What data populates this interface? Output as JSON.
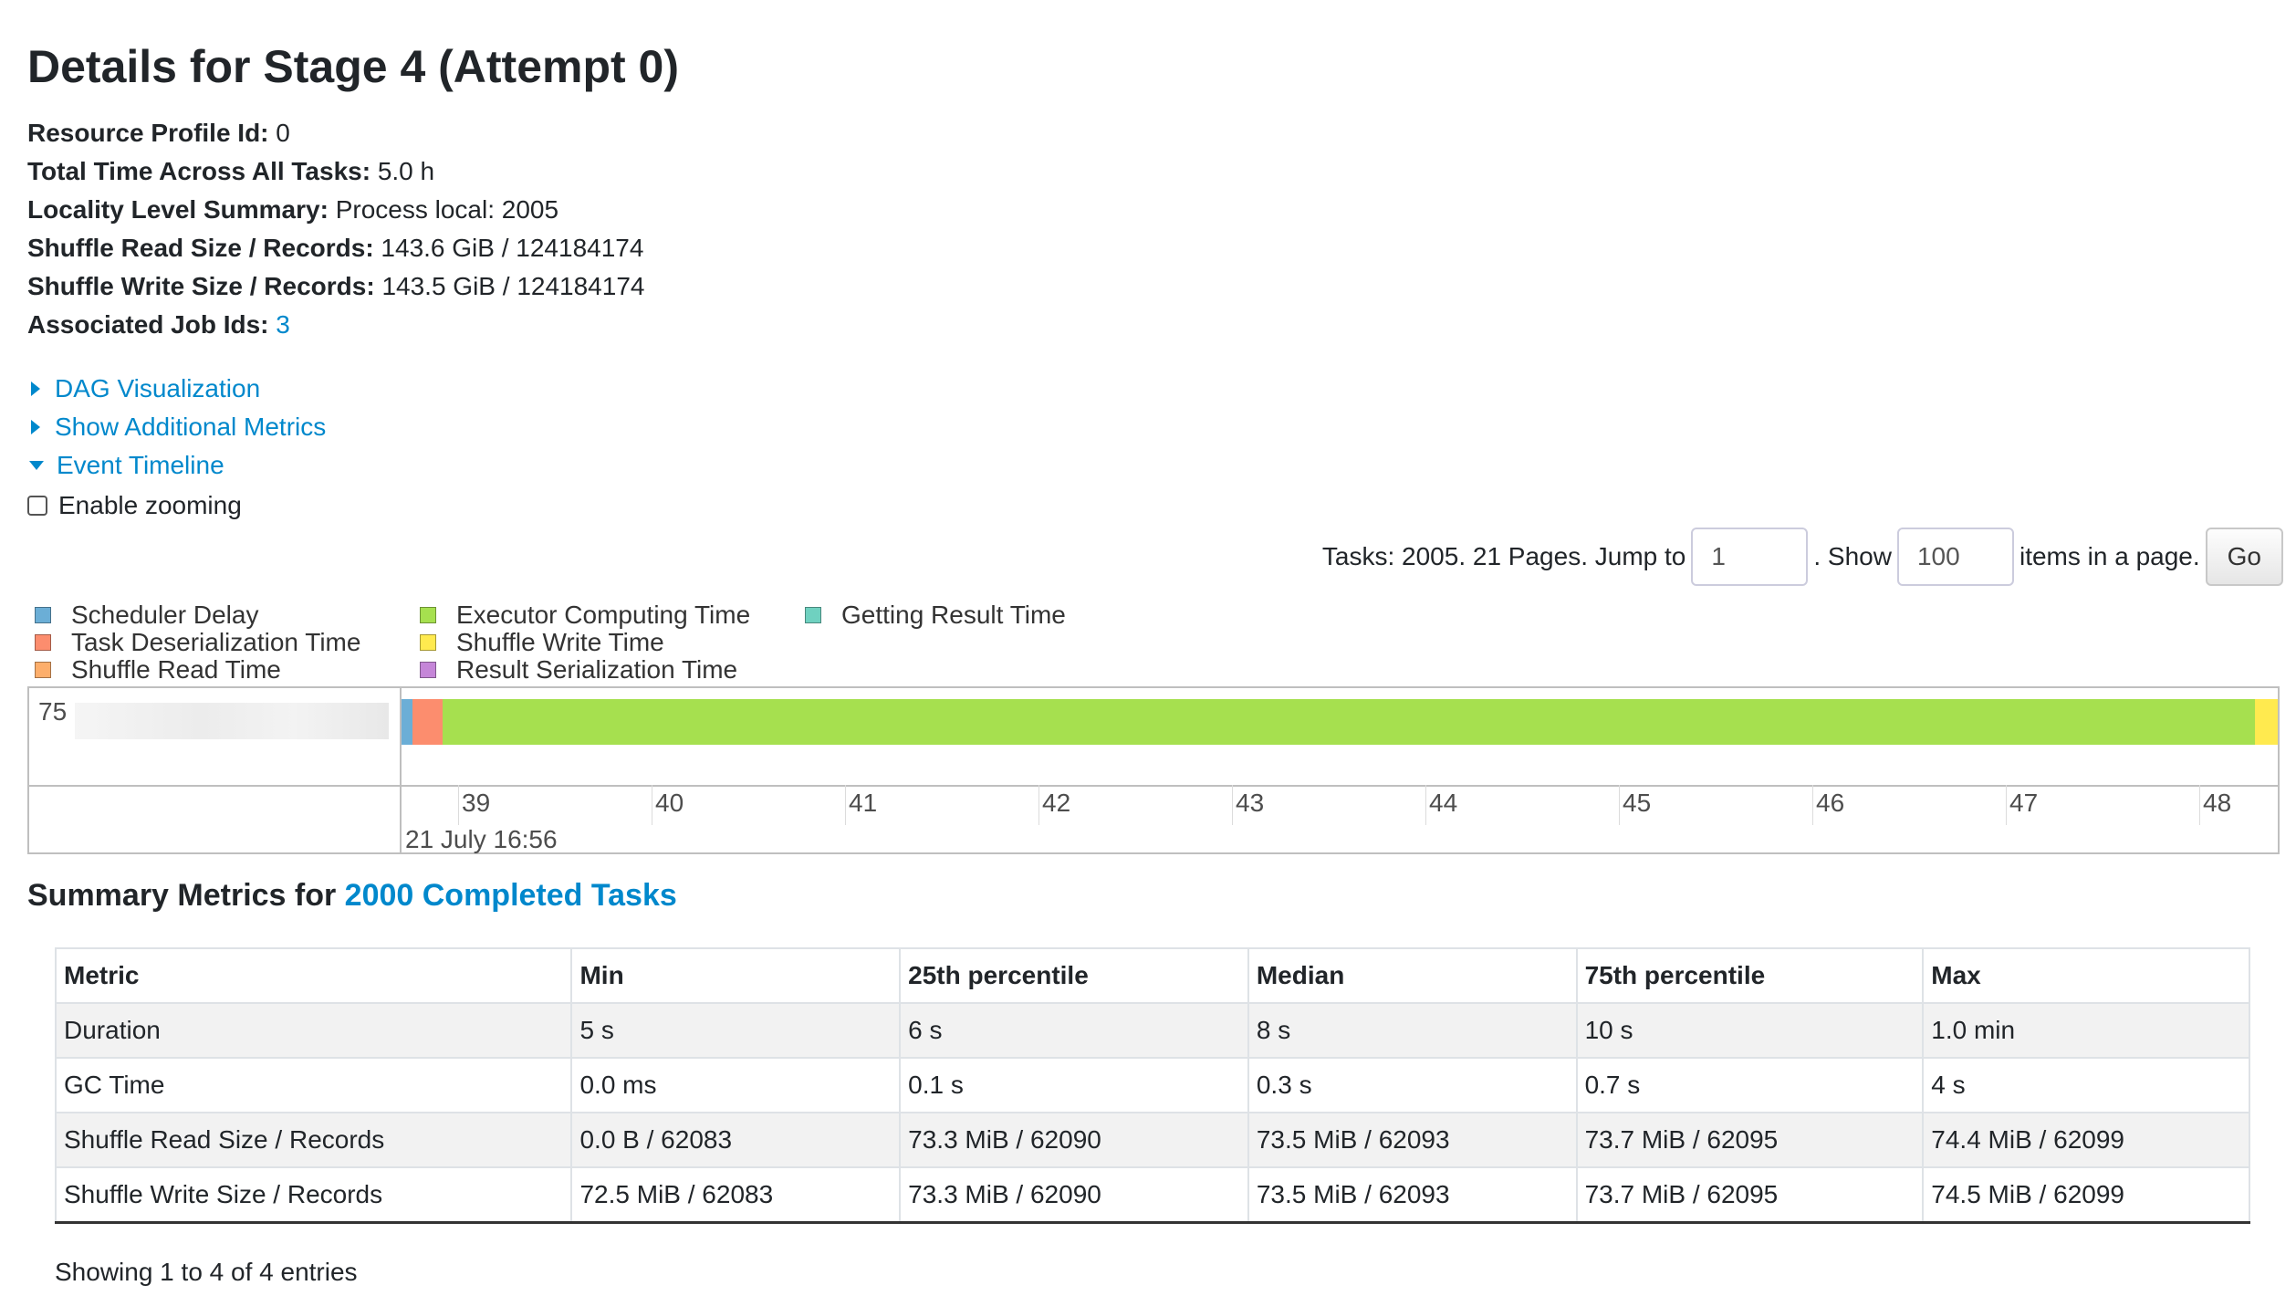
{
  "page_title": "Details for Stage 4 (Attempt 0)",
  "info": [
    {
      "label": "Resource Profile Id:",
      "value": "0"
    },
    {
      "label": "Total Time Across All Tasks:",
      "value": "5.0 h"
    },
    {
      "label": "Locality Level Summary:",
      "value": "Process local: 2005"
    },
    {
      "label": "Shuffle Read Size / Records:",
      "value": "143.6 GiB / 124184174"
    },
    {
      "label": "Shuffle Write Size / Records:",
      "value": "143.5 GiB / 124184174"
    },
    {
      "label": "Associated Job Ids:",
      "value": "3"
    }
  ],
  "toggles": {
    "dag": "DAG Visualization",
    "additional_metrics": "Show Additional Metrics",
    "event_timeline": "Event Timeline"
  },
  "enable_zooming": "Enable zooming",
  "pager": {
    "prefix": "Tasks: 2005. 21 Pages. Jump to",
    "page_value": "1",
    "show_text": ". Show",
    "size_value": "100",
    "suffix": "items in a page.",
    "go_label": "Go"
  },
  "legend": [
    {
      "label": "Scheduler Delay",
      "color": "#6baed6"
    },
    {
      "label": "Task Deserialization Time",
      "color": "#fc8d6e"
    },
    {
      "label": "Shuffle Read Time",
      "color": "#fdae6b"
    },
    {
      "label": "Executor Computing Time",
      "color": "#a6e04f"
    },
    {
      "label": "Shuffle Write Time",
      "color": "#ffea4f"
    },
    {
      "label": "Result Serialization Time",
      "color": "#c586d8"
    },
    {
      "label": "Getting Result Time",
      "color": "#6fd1c0"
    }
  ],
  "timeline": {
    "task_label": "75",
    "ticks": [
      "39",
      "40",
      "41",
      "42",
      "43",
      "44",
      "45",
      "46",
      "47",
      "48"
    ],
    "date_label": "21 July 16:56",
    "task_segments": [
      {
        "kind": "Scheduler Delay",
        "fraction": 0.006,
        "color": "#6baed6"
      },
      {
        "kind": "Task Deserialization Time",
        "fraction": 0.016,
        "color": "#fc8d6e"
      },
      {
        "kind": "Executor Computing Time",
        "fraction": 0.966,
        "color": "#a6e04f"
      },
      {
        "kind": "Shuffle Write Time",
        "fraction": 0.012,
        "color": "#ffea4f"
      }
    ]
  },
  "summary": {
    "prefix": "Summary Metrics for ",
    "link": "2000 Completed Tasks"
  },
  "table": {
    "headers": [
      "Metric",
      "Min",
      "25th percentile",
      "Median",
      "75th percentile",
      "Max"
    ],
    "rows": [
      [
        "Duration",
        "5 s",
        "6 s",
        "8 s",
        "10 s",
        "1.0 min"
      ],
      [
        "GC Time",
        "0.0 ms",
        "0.1 s",
        "0.3 s",
        "0.7 s",
        "4 s"
      ],
      [
        "Shuffle Read Size / Records",
        "0.0 B / 62083",
        "73.3 MiB / 62090",
        "73.5 MiB / 62093",
        "73.7 MiB / 62095",
        "74.4 MiB / 62099"
      ],
      [
        "Shuffle Write Size / Records",
        "72.5 MiB / 62083",
        "73.3 MiB / 62090",
        "73.5 MiB / 62093",
        "73.7 MiB / 62095",
        "74.5 MiB / 62099"
      ]
    ]
  },
  "showing": "Showing 1 to 4 of 4 entries"
}
